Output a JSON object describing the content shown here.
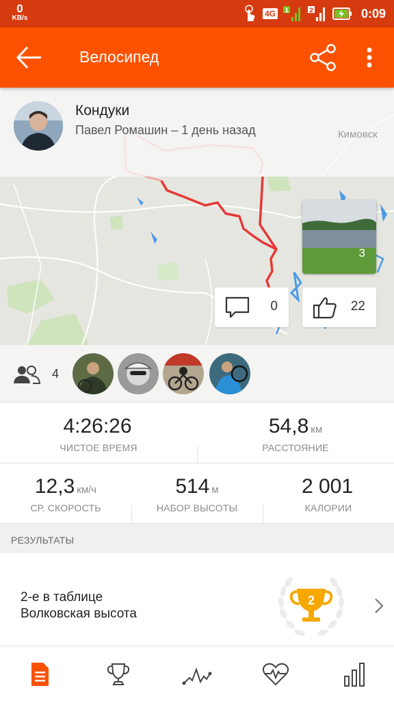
{
  "status_bar": {
    "net_speed_value": "0",
    "net_speed_unit": "KB/s",
    "network_type": "4G",
    "sim2_label": "2",
    "time": "0:09"
  },
  "app_bar": {
    "title": "Велосипед"
  },
  "activity": {
    "name": "Кондуки",
    "meta": "Павел Ромашин – 1 день назад"
  },
  "map": {
    "place_label": "Кимовск",
    "photo_count": "3",
    "comments_count": "0",
    "kudos_count": "22"
  },
  "athletes": {
    "count": "4"
  },
  "stats": {
    "moving_time": {
      "value": "4:26:26",
      "unit": "",
      "label": "ЧИСТОЕ ВРЕМЯ"
    },
    "distance": {
      "value": "54,8",
      "unit": "км",
      "label": "РАССТОЯНИЕ"
    },
    "avg_speed": {
      "value": "12,3",
      "unit": "км/ч",
      "label": "СР. СКОРОСТЬ"
    },
    "elevation": {
      "value": "514",
      "unit": "м",
      "label": "НАБОР ВЫСОТЫ"
    },
    "calories": {
      "value": "2 001",
      "unit": "",
      "label": "КАЛОРИИ"
    }
  },
  "results": {
    "header": "РЕЗУЛЬТАТЫ",
    "line1": "2-е в таблице",
    "line2": "Волковская высота",
    "rank": "2"
  },
  "colors": {
    "accent": "#fc5200",
    "status_bar": "#d63b0f",
    "route": "#e53935",
    "trophy_gold": "#f5a800"
  },
  "icons": {
    "back": "arrow-left-icon",
    "share": "share-icon",
    "more": "more-vertical-icon",
    "comment": "comment-icon",
    "kudos": "thumbs-up-icon",
    "athletes": "group-icon",
    "nav": [
      "overview-icon",
      "trophy-icon",
      "analysis-icon",
      "heart-rate-icon",
      "stats-icon"
    ]
  }
}
